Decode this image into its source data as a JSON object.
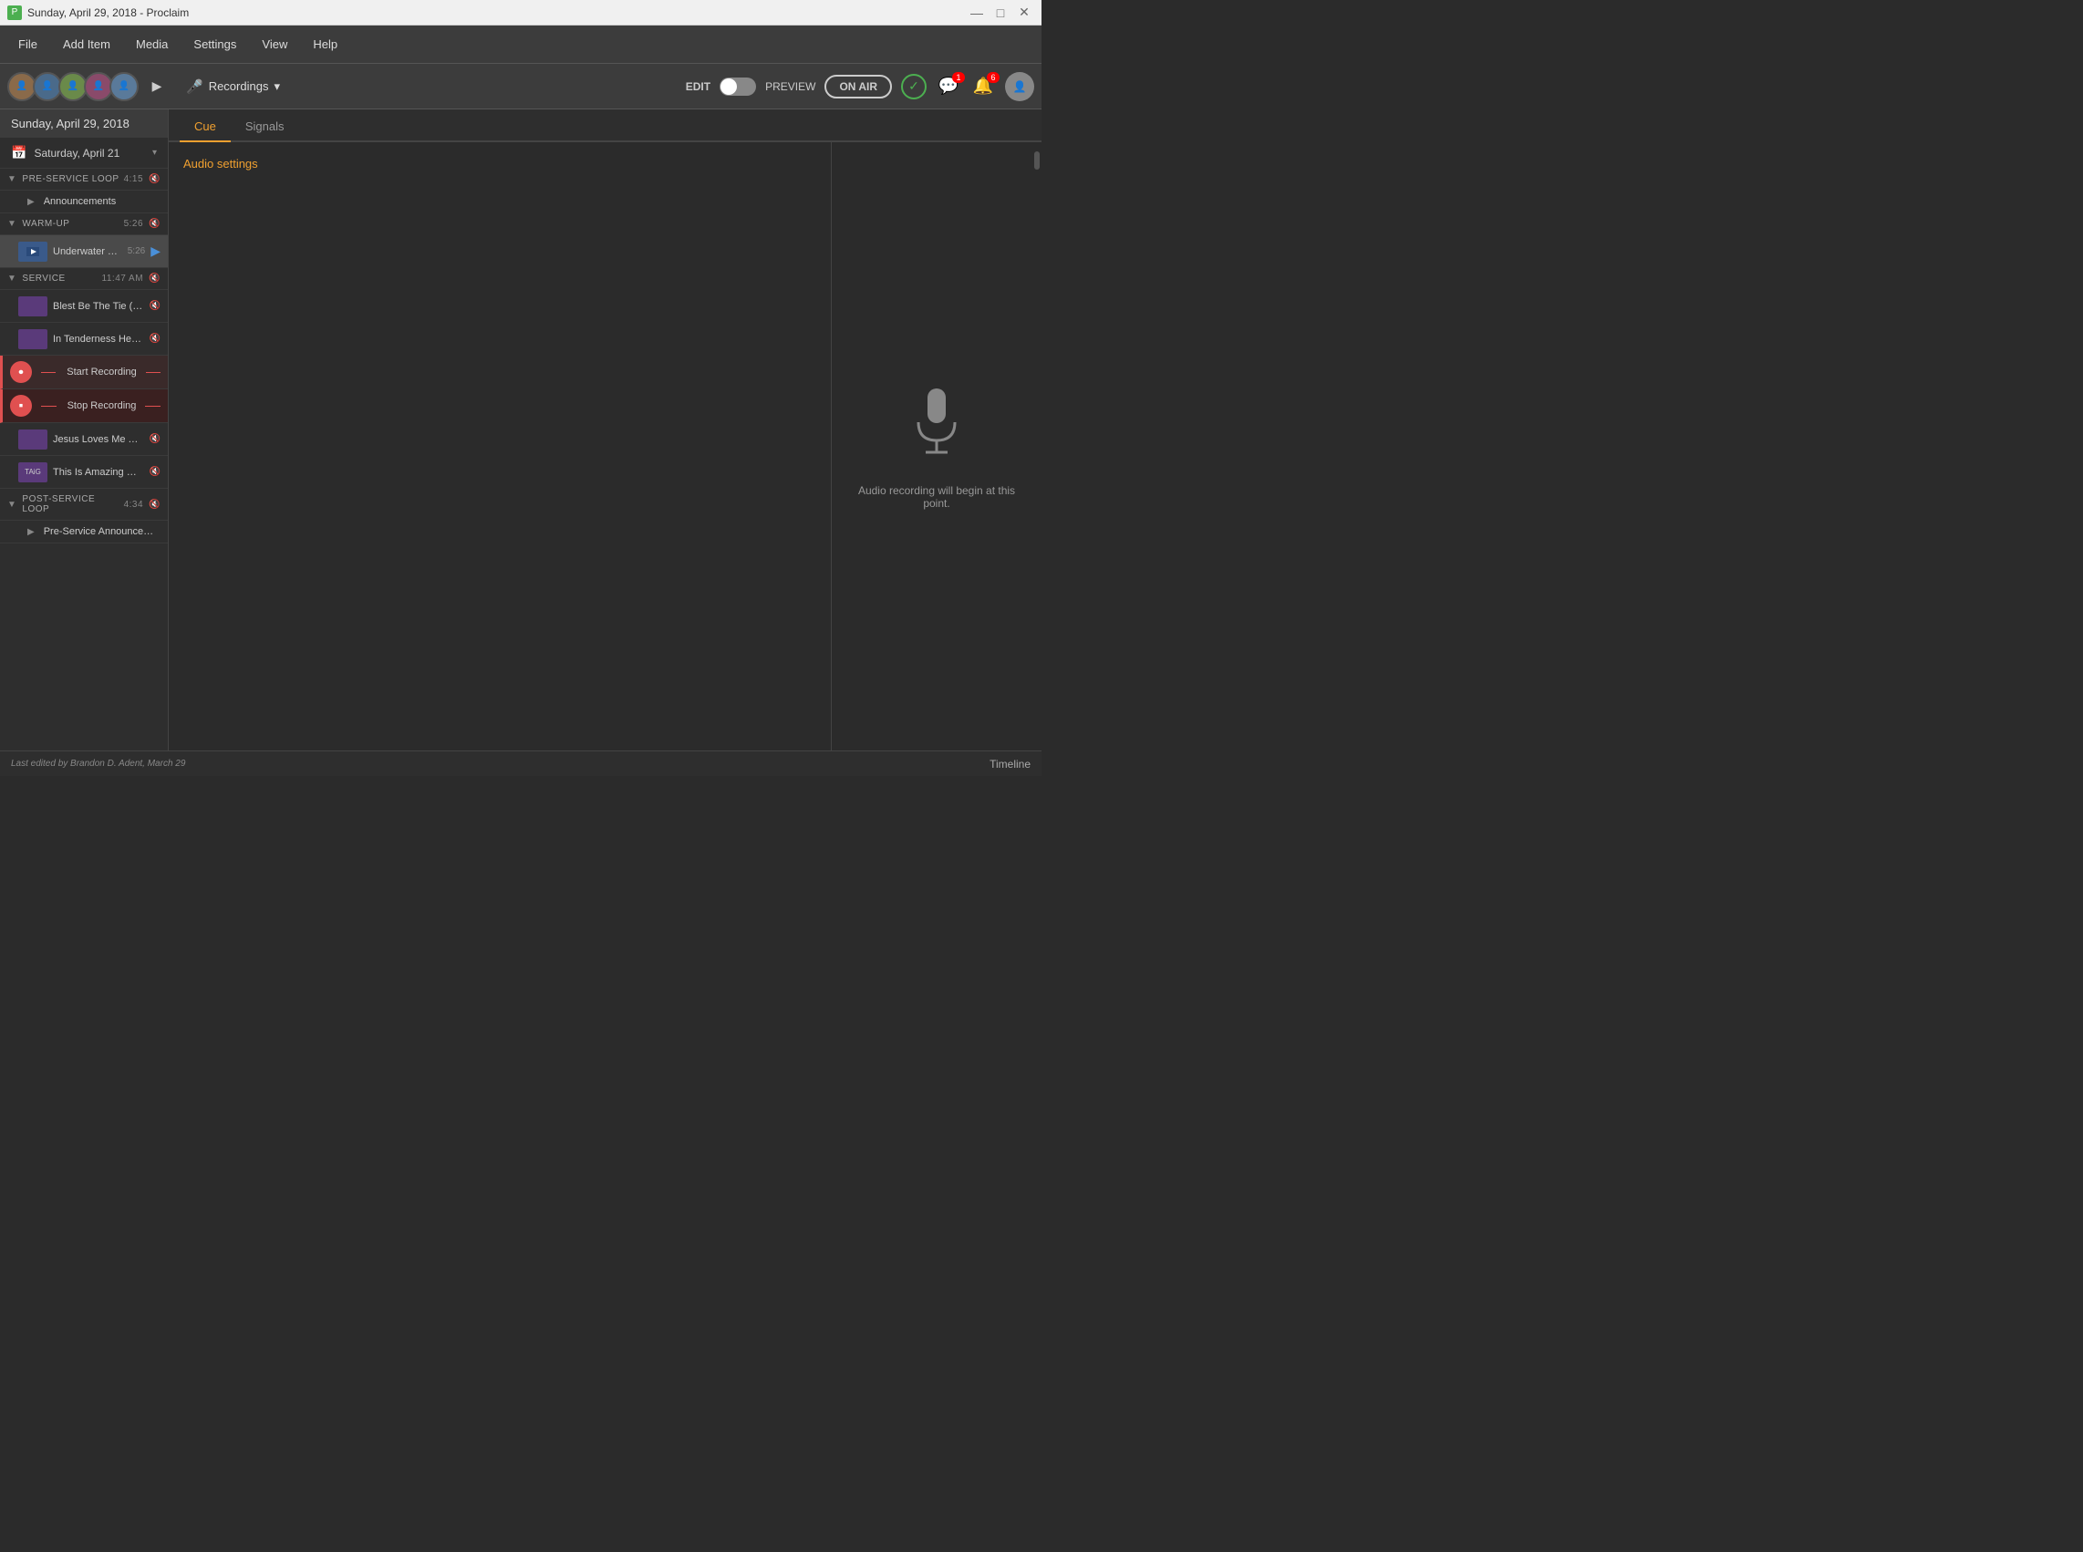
{
  "window": {
    "title": "Sunday, April 29, 2018 - Proclaim",
    "icon": "P"
  },
  "titlebar": {
    "minimize": "—",
    "maximize": "□",
    "close": "✕"
  },
  "menubar": {
    "items": [
      "File",
      "Add Item",
      "Media",
      "Settings",
      "View",
      "Help"
    ]
  },
  "toolbar": {
    "recordings_label": "Recordings",
    "edit_label": "EDIT",
    "preview_label": "PREVIEW",
    "on_air_label": "ON AIR",
    "messages_badge": "1",
    "notifications_badge": "6"
  },
  "sidebar": {
    "current_date": "Sunday, April 29, 2018",
    "nav_date": "Saturday, April 21",
    "sections": [
      {
        "name": "PRE-SERVICE LOOP",
        "time": "4:15",
        "children": [
          {
            "label": "Announcements",
            "type": "group"
          }
        ]
      },
      {
        "name": "WARM-UP",
        "time": "5:26",
        "children": [
          {
            "label": "Underwater Countdown",
            "time": "5:26",
            "type": "video",
            "active": true
          }
        ]
      },
      {
        "name": "SERVICE",
        "time": "11:47 AM",
        "children": [
          {
            "label": "Blest Be The Tie (Canticle Of Fello...",
            "type": "song"
          },
          {
            "label": "In Tenderness He Sought Me (In Te...",
            "type": "song"
          },
          {
            "label": "Start Recording",
            "type": "recording-start"
          },
          {
            "label": "Stop Recording",
            "type": "recording-stop"
          },
          {
            "label": "Jesus Loves Me This I Know (Jesus...",
            "type": "song"
          },
          {
            "label": "This Is Amazing Grace ♪",
            "type": "song"
          }
        ]
      },
      {
        "name": "POST-SERVICE LOOP",
        "time": "4:34",
        "children": [
          {
            "label": "Pre-Service Announcements",
            "type": "group"
          }
        ]
      }
    ]
  },
  "tabs": {
    "items": [
      "Cue",
      "Signals"
    ],
    "active": "Cue"
  },
  "content": {
    "audio_settings_label": "Audio settings",
    "recording_notice": "Audio recording will begin at this point.",
    "last_edited": "Last edited by Brandon D. Adent, March 29"
  },
  "footer": {
    "timeline_label": "Timeline"
  },
  "colors": {
    "accent": "#f0a030",
    "recording": "#e05050",
    "active_tab": "#f0a030",
    "green": "#4CAF50"
  }
}
